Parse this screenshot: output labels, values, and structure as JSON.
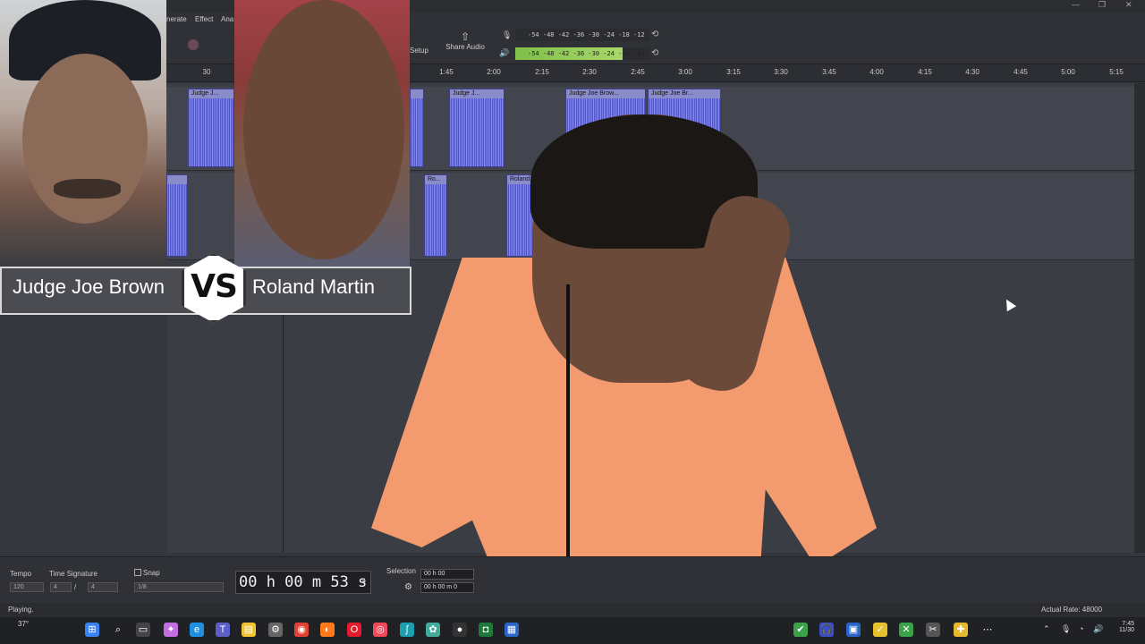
{
  "menu": {
    "items": [
      "nerate",
      "Effect",
      "Ana"
    ]
  },
  "toolbar": {
    "setup_label": "Setup",
    "share_label": "Share Audio"
  },
  "meters": {
    "record_scale": "-54 -48 -42 -36 -30 -24 -18 -12 -6",
    "play_scale": "-54 -48 -42 -36 -30 -24 -18 -12 -6",
    "record_channels": "L R",
    "play_channels": "L R"
  },
  "ruler": {
    "ticks": [
      "30",
      "1:45",
      "2:00",
      "2:15",
      "2:30",
      "2:45",
      "3:00",
      "3:15",
      "3:30",
      "3:45",
      "4:00",
      "4:15",
      "4:30",
      "4:45",
      "5:00",
      "5:15"
    ]
  },
  "clips": {
    "t1_a": "Judge J...",
    "t1_b": "Judge J...",
    "t1_c": "Judge Joe Brow...",
    "t1_d": "Judge Joe Br...",
    "t2_a": "Ro...",
    "t2_b": "Roland..."
  },
  "overlay": {
    "left_name": "Judge Joe Brown",
    "vs": "VS",
    "right_name": "Roland Martin"
  },
  "bottom": {
    "tempo_label": "Tempo",
    "tempo_value": "120",
    "time_sig_label": "Time Signature",
    "time_sig_num": "4",
    "time_sig_den": "4",
    "snap_label": "Snap",
    "snap_value": "1/8",
    "time_display": "00 h 00 m 53 s",
    "selection_label": "Selection",
    "selection_start": "00 h 00",
    "selection_end": "00 h 00 m 0"
  },
  "status": {
    "left": "Playing.",
    "right": "Actual Rate: 48000"
  },
  "taskbar": {
    "weather": "37°",
    "time": "7:45",
    "date": "11/30"
  },
  "colors": {
    "clip": "#5b5ed1",
    "clip_header": "#8a8cc9",
    "shirt": "#f39a6f",
    "meter_green": "#a8d86a"
  }
}
